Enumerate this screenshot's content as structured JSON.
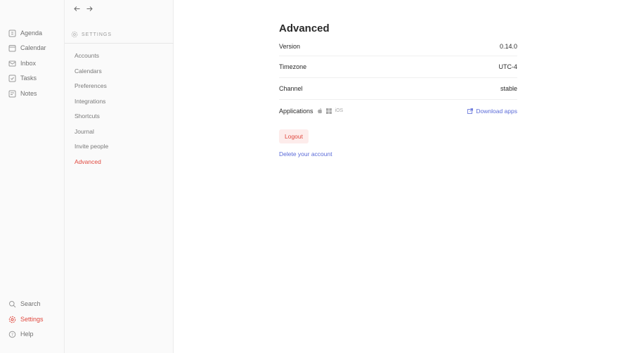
{
  "nav": {
    "items": [
      {
        "label": "Agenda",
        "icon": "agenda-icon"
      },
      {
        "label": "Calendar",
        "icon": "calendar-icon"
      },
      {
        "label": "Inbox",
        "icon": "inbox-icon"
      },
      {
        "label": "Tasks",
        "icon": "tasks-icon"
      },
      {
        "label": "Notes",
        "icon": "notes-icon"
      }
    ],
    "bottom": [
      {
        "label": "Search",
        "icon": "search-icon"
      },
      {
        "label": "Settings",
        "icon": "gear-icon",
        "active": true
      },
      {
        "label": "Help",
        "icon": "help-icon"
      }
    ]
  },
  "settings": {
    "header": "SETTINGS",
    "items": [
      {
        "label": "Accounts"
      },
      {
        "label": "Calendars"
      },
      {
        "label": "Preferences"
      },
      {
        "label": "Integrations"
      },
      {
        "label": "Shortcuts"
      },
      {
        "label": "Journal"
      },
      {
        "label": "Invite people"
      },
      {
        "label": "Advanced",
        "active": true
      }
    ]
  },
  "main": {
    "title": "Advanced",
    "rows": [
      {
        "label": "Version",
        "value": "0.14.0"
      },
      {
        "label": "Timezone",
        "value": "UTC-4"
      },
      {
        "label": "Channel",
        "value": "stable"
      }
    ],
    "applications": {
      "label": "Applications",
      "platforms": [
        "apple-icon",
        "windows-icon"
      ],
      "ios": "iOS",
      "download": "Download apps"
    },
    "logout": "Logout",
    "delete": "Delete your account"
  },
  "colors": {
    "accent": "#e0483e",
    "link": "#5a6ad8"
  }
}
